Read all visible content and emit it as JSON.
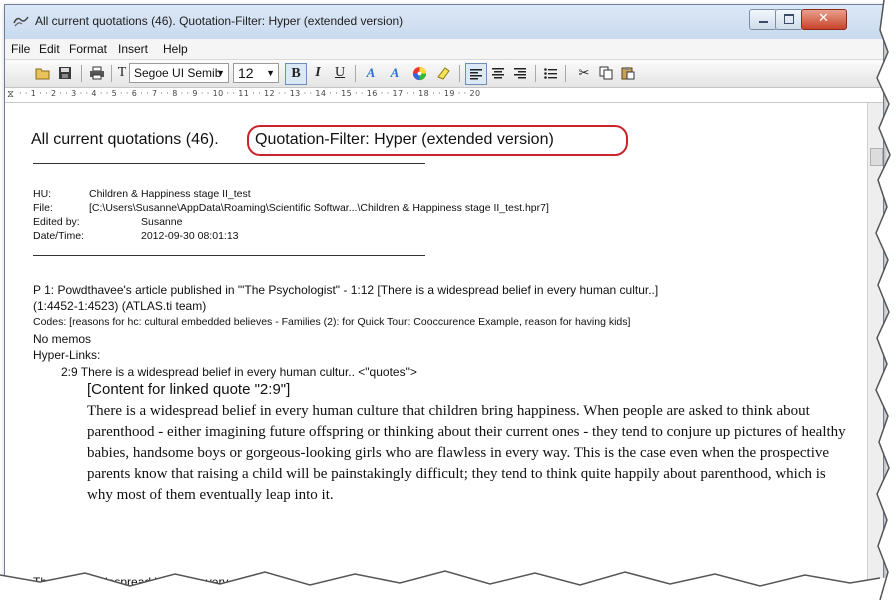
{
  "window": {
    "title": "All current quotations (46). Quotation-Filter: Hyper (extended version)"
  },
  "menu": [
    "File",
    "Edit",
    "Format",
    "Insert",
    "Help"
  ],
  "toolbar": {
    "font_name": "Segoe UI Semib",
    "font_size": "12",
    "bold_label": "B",
    "italic_label": "I",
    "underline_label": "U",
    "icons": [
      "open-icon",
      "save-icon",
      "print-icon",
      "font-icon",
      "bold",
      "italic",
      "underline",
      "text-color-a-icon",
      "highlight-a-icon",
      "color-wheel-icon",
      "eraser-icon",
      "align-left-icon",
      "align-center-icon",
      "align-right-icon",
      "bullets-icon",
      "cut-icon",
      "copy-icon",
      "paste-icon"
    ]
  },
  "ruler": {
    "text": "· · 1 · · 2 · · 3 · · 4 · · 5 · · 6 · · 7 · · 8 · · 9 · · 10 · · 11 · · 12 · · 13 · · 14 · · 15 · · 16 · · 17 · · 18 · · 19 · · 20"
  },
  "document": {
    "heading_part1": "All current quotations (46).",
    "heading_part2": "Quotation-Filter: Hyper (extended version)",
    "hu_label": "HU:",
    "hu_value": "Children & Happiness stage II_test",
    "file_label": "File:",
    "file_value": "[C:\\Users\\Susanne\\AppData\\Roaming\\Scientific Softwar...\\Children & Happiness stage II_test.hpr7]",
    "edited_label": "Edited by:",
    "edited_value": "Susanne",
    "date_label": "Date/Time:",
    "date_value": "2012-09-30 08:01:13",
    "p1_line1": "P 1: Powdthavee's article published in \"'The Psychologist\" - 1:12 [There is a widespread belief in every human cultur..]",
    "p1_line2": "(1:4452-1:4523)   (ATLAS.ti team)",
    "codes_line": "Codes:   [reasons for hc: cultural embedded believes - Families (2): for Quick Tour: Cooccurence Example, reason for having kids]",
    "no_memos": "No memos",
    "hyperlinks_label": "Hyper-Links:",
    "link_line": "2:9 There is a widespread belief in every human cultur.. <\"quotes\">",
    "linked_heading": "[Content for linked quote \"2:9\"]",
    "linked_body": "There is a widespread belief in every human culture that children bring happiness. When people are asked to think about parenthood - either imagining future offspring or thinking about their current ones - they tend to conjure up pictures of healthy babies, handsome boys or gorgeous-looking girls who are flawless in every way. This is the case even when the prospective parents know that raising a child will be painstakingly difficult; they tend to think quite happily about parenthood, which is why most of them eventually leap into it.",
    "bottom_line": "There is a widespread belief in every"
  },
  "colors": {
    "highlight_ellipse": "#c9242b",
    "close_button": "#c7432a",
    "title_gradient": "#c9daef"
  }
}
